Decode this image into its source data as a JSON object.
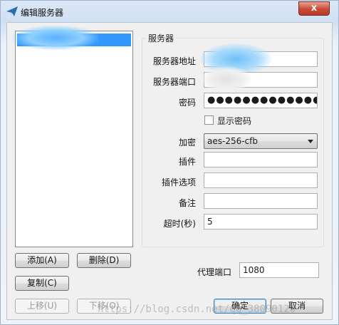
{
  "window": {
    "title": "编辑服务器",
    "close_glyph": "x"
  },
  "server_list": {
    "items": [
      {
        "label": "",
        "selected": true
      }
    ]
  },
  "list_buttons": {
    "add": "添加(A)",
    "delete": "删除(D)",
    "copy": "复制(C)",
    "move_up": "上移(U)",
    "move_down": "下移(O)"
  },
  "server_group": {
    "title": "服务器",
    "address_label": "服务器地址",
    "address_value": "",
    "port_label": "服务器端口",
    "port_value": "",
    "password_label": "密码",
    "password_value": "●●●●●●●●●●●●●●●●",
    "show_password_label": "显示密码",
    "show_password_checked": false,
    "encryption_label": "加密",
    "encryption_value": "aes-256-cfb",
    "plugin_label": "插件",
    "plugin_value": "",
    "plugin_options_label": "插件选项",
    "plugin_options_value": "",
    "remarks_label": "备注",
    "remarks_value": "",
    "timeout_label": "超时(秒)",
    "timeout_value": "5"
  },
  "proxy": {
    "port_label": "代理端口",
    "port_value": "1080"
  },
  "dialog_buttons": {
    "ok": "确定",
    "cancel": "取消"
  },
  "watermark": "https://blog.csdn.net/qq_38090120",
  "icons": {
    "app": "paper-plane-icon",
    "close": "close-icon",
    "dropdown": "chevron-down-icon"
  },
  "colors": {
    "selection": "#3399ff",
    "close_button": "#c94a35"
  }
}
